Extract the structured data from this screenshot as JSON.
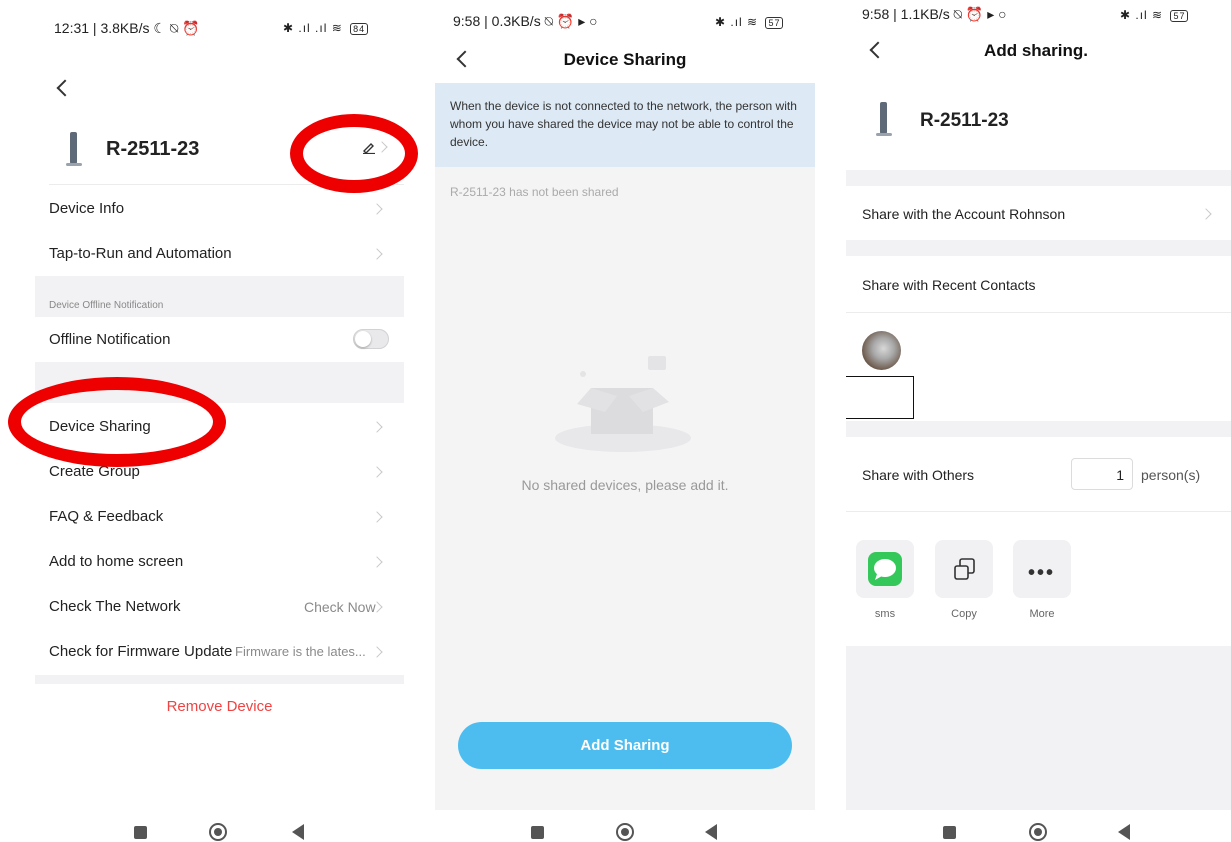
{
  "panel1": {
    "status_time": "12:31 | 3.8KB/s",
    "status_left_icons": "☾ ⍉ ⏰",
    "status_right_icons": "✱ .ıl .ıl ≋",
    "battery": "84",
    "device_name": "R-2511-23",
    "rows": {
      "device_info": "Device Info",
      "tap_to_run": "Tap-to-Run and Automation",
      "offline_section_header": "Device Offline Notification",
      "offline_notification": "Offline Notification",
      "device_sharing": "Device Sharing",
      "create_group": "Create Group",
      "faq": "FAQ & Feedback",
      "add_home": "Add to home screen",
      "check_network": "Check The Network",
      "check_network_value": "Check Now",
      "firmware": "Check for Firmware Update",
      "firmware_value": "Firmware is the lates..."
    },
    "remove_device": "Remove Device"
  },
  "panel2": {
    "status_time": "9:58 | 0.3KB/s",
    "status_left_icons": "⍉ ⏰ ▸ ○",
    "status_right_icons": "✱ .ıl ≋",
    "battery": "57",
    "title": "Device Sharing",
    "notice": "When the device is not connected to the network, the person with whom you have shared the device may not be able to control the device.",
    "not_shared": "R-2511-23 has not been shared",
    "empty_text": "No shared devices, please add it.",
    "add_button": "Add Sharing"
  },
  "panel3": {
    "status_time": "9:58 | 1.1KB/s",
    "status_left_icons": "⍉ ⏰ ▸ ○",
    "status_right_icons": "✱ .ıl ≋",
    "battery": "57",
    "title": "Add sharing.",
    "device_name": "R-2511-23",
    "share_account": "Share with the Account Rohnson",
    "share_recent": "Share with Recent Contacts",
    "share_others": "Share with Others",
    "person_count": "1",
    "person_unit": "person(s)",
    "tiles": {
      "sms": "sms",
      "copy": "Copy",
      "more": "More"
    }
  },
  "colors": {
    "accent_blue": "#4dbdef",
    "remove_red": "#ee4444",
    "annotation_red": "#ee0000",
    "notice_bg": "#dde9f4",
    "sms_green": "#34c759"
  }
}
